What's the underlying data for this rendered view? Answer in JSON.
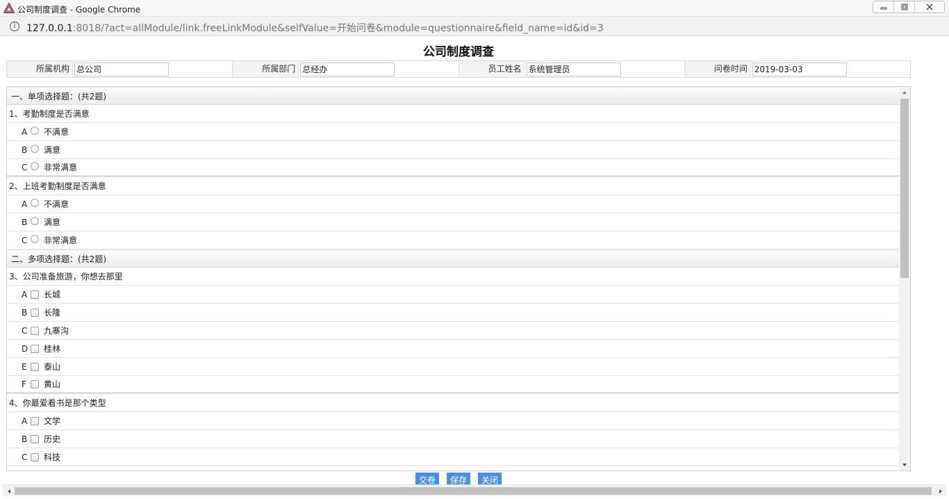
{
  "window": {
    "title": "公司制度调查 - Google Chrome"
  },
  "address": {
    "host": "127.0.0.1",
    "rest": ":8018/?act=allModule/link.freeLinkModule&selfValue=开始问卷&module=questionnaire&field_name=id&id=3"
  },
  "page": {
    "title": "公司制度调查"
  },
  "info": {
    "org_label": "所属机构",
    "org_value": "总公司",
    "dept_label": "所属部门",
    "dept_value": "总经办",
    "name_label": "员工姓名",
    "name_value": "系统管理员",
    "date_label": "问卷时间",
    "date_value": "2019-03-03"
  },
  "survey": {
    "single_header": "一、单项选择题：(共2题)",
    "multi_header": "二、多项选择题：(共2题)",
    "q1": {
      "text": "1、考勤制度是否满意",
      "options": [
        {
          "letter": "A",
          "text": "不满意"
        },
        {
          "letter": "B",
          "text": "满意"
        },
        {
          "letter": "C",
          "text": "非常满意"
        }
      ]
    },
    "q2": {
      "text": "2、上班考勤制度是否满意",
      "options": [
        {
          "letter": "A",
          "text": "不满意"
        },
        {
          "letter": "B",
          "text": "满意"
        },
        {
          "letter": "C",
          "text": "非常满意"
        }
      ]
    },
    "q3": {
      "text": "3、公司准备旅游，你想去那里",
      "options": [
        {
          "letter": "A",
          "text": "长城"
        },
        {
          "letter": "B",
          "text": "长隆"
        },
        {
          "letter": "C",
          "text": "九寨沟"
        },
        {
          "letter": "D",
          "text": "桂林"
        },
        {
          "letter": "E",
          "text": "泰山"
        },
        {
          "letter": "F",
          "text": "黄山"
        }
      ]
    },
    "q4": {
      "text": "4、你最爱看书是那个类型",
      "options": [
        {
          "letter": "A",
          "text": "文学"
        },
        {
          "letter": "B",
          "text": "历史"
        },
        {
          "letter": "C",
          "text": "科技"
        }
      ]
    }
  },
  "buttons": {
    "submit": "交卷",
    "save": "保存",
    "close": "关闭"
  }
}
